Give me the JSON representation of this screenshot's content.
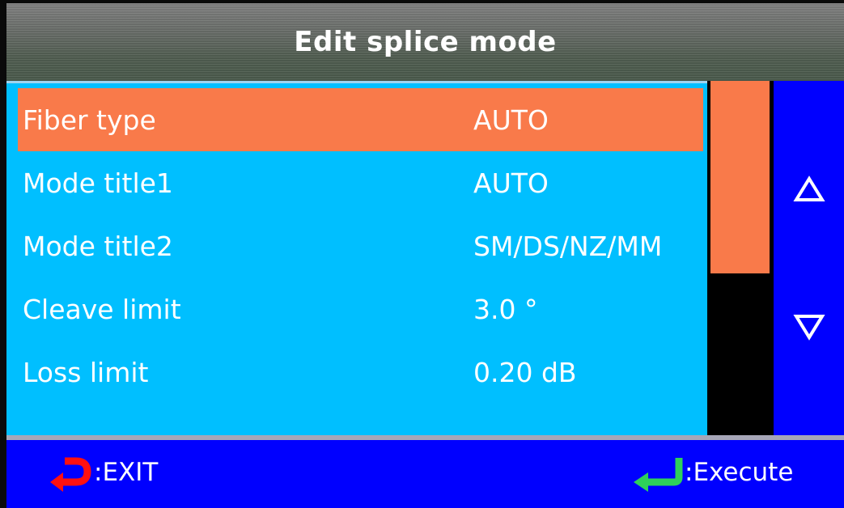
{
  "header": {
    "title": "Edit splice mode"
  },
  "menu": {
    "items": [
      {
        "label": "Fiber type",
        "value": "AUTO",
        "selected": true
      },
      {
        "label": "Mode title1",
        "value": "AUTO",
        "selected": false
      },
      {
        "label": "Mode title2",
        "value": "SM/DS/NZ/MM",
        "selected": false
      },
      {
        "label": "Cleave limit",
        "value": "3.0 °",
        "selected": false
      },
      {
        "label": "Loss limit",
        "value": "0.20 dB",
        "selected": false
      }
    ]
  },
  "scroll": {
    "up_icon": "triangle-up-icon",
    "down_icon": "triangle-down-icon"
  },
  "footer": {
    "exit_label": ":EXIT",
    "exit_icon": "return-arrow-icon",
    "execute_label": ":Execute",
    "execute_icon": "enter-arrow-icon"
  },
  "colors": {
    "list_background": "#00bfff",
    "selection": "#f97a4a",
    "panel_blue": "#0000ff",
    "exit_icon": "#ff1010",
    "execute_icon": "#2ed05a"
  }
}
